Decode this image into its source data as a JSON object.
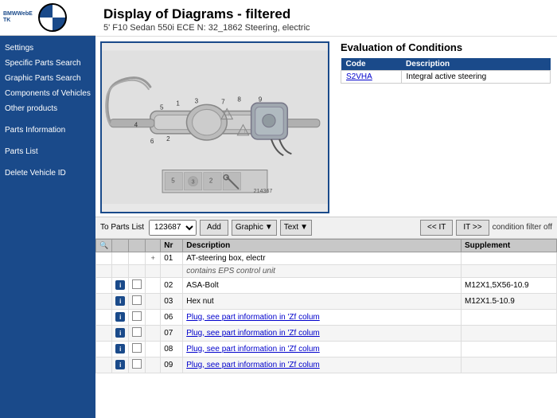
{
  "sidebar": {
    "logo_text": "BMWWebETK",
    "nav_items": [
      {
        "label": "Settings",
        "name": "settings"
      },
      {
        "label": "Specific Parts Search",
        "name": "specific-parts-search"
      },
      {
        "label": "Graphic Parts Search",
        "name": "graphic-parts-search"
      },
      {
        "label": "Components of Vehicles",
        "name": "components-of-vehicles"
      },
      {
        "label": "Other products",
        "name": "other-products"
      },
      {
        "label": "Parts Information",
        "name": "parts-information"
      },
      {
        "label": "Parts List",
        "name": "parts-list"
      },
      {
        "label": "Delete Vehicle ID",
        "name": "delete-vehicle-id"
      }
    ]
  },
  "header": {
    "title": "Display of Diagrams - filtered",
    "subtitle": "5' F10 Sedan 550i ECE N: 32_1862 Steering, electric"
  },
  "evaluation": {
    "title": "Evaluation of Conditions",
    "table_headers": [
      "Code",
      "Description"
    ],
    "rows": [
      {
        "code": "S2VHA",
        "description": "Integral active steering"
      }
    ]
  },
  "toolbar": {
    "label": "To Parts List",
    "select_value": "123687",
    "add_label": "Add",
    "graphic_label": "Graphic",
    "text_label": "Text",
    "prev_label": "<< IT",
    "next_label": "IT >>",
    "condition_text": "condition filter off"
  },
  "parts_table": {
    "headers": [
      "",
      "",
      "",
      "Nr",
      "Description",
      "Supplement"
    ],
    "rows": [
      {
        "info": true,
        "check": false,
        "plus": true,
        "nr": "01",
        "description": "AT-steering box, electr",
        "supplement": "",
        "sub": true,
        "sub_text": "contains EPS control unit",
        "link": false
      },
      {
        "info": true,
        "check": true,
        "plus": false,
        "nr": "02",
        "description": "ASA-Bolt",
        "supplement": "M12X1,5X56-10.9",
        "sub": false,
        "link": false
      },
      {
        "info": true,
        "check": true,
        "plus": false,
        "nr": "03",
        "description": "Hex nut",
        "supplement": "M12X1.5-10.9",
        "sub": false,
        "link": false
      },
      {
        "info": true,
        "check": true,
        "plus": false,
        "nr": "06",
        "description": "Plug, see part information in 'Zf colum",
        "supplement": "",
        "sub": false,
        "link": true
      },
      {
        "info": true,
        "check": true,
        "plus": false,
        "nr": "07",
        "description": "Plug, see part information in 'Zf colum",
        "supplement": "",
        "sub": false,
        "link": true
      },
      {
        "info": true,
        "check": true,
        "plus": false,
        "nr": "08",
        "description": "Plug, see part information in 'Zf colum",
        "supplement": "",
        "sub": false,
        "link": true
      },
      {
        "info": true,
        "check": true,
        "plus": false,
        "nr": "09",
        "description": "Plug, see part information in 'Zf colum",
        "supplement": "",
        "sub": false,
        "link": true
      }
    ]
  },
  "icons": {
    "search": "🔍",
    "dropdown": "▼",
    "info": "i",
    "plus": "+"
  }
}
